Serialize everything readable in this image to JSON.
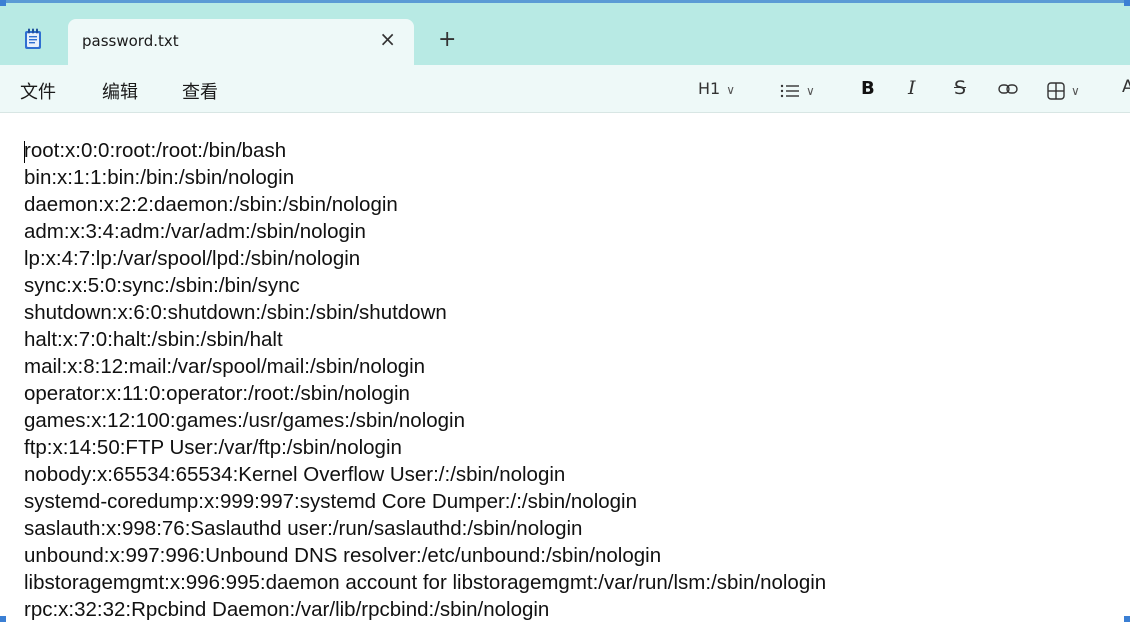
{
  "window": {
    "tab": {
      "title": "password.txt",
      "close_label": "×"
    },
    "new_tab_label": "+"
  },
  "menu": [
    "文件",
    "编辑",
    "查看"
  ],
  "toolbar": {
    "heading_label": "H1",
    "chevron": "∨",
    "list_icon": "list-icon",
    "bold_label": "B",
    "italic_label": "I",
    "strike_label": "S",
    "overflow_label": "A"
  },
  "editor": {
    "lines": [
      "root:x:0:0:root:/root:/bin/bash",
      "bin:x:1:1:bin:/bin:/sbin/nologin",
      "daemon:x:2:2:daemon:/sbin:/sbin/nologin",
      "adm:x:3:4:adm:/var/adm:/sbin/nologin",
      "lp:x:4:7:lp:/var/spool/lpd:/sbin/nologin",
      "sync:x:5:0:sync:/sbin:/bin/sync",
      "shutdown:x:6:0:shutdown:/sbin:/sbin/shutdown",
      "halt:x:7:0:halt:/sbin:/sbin/halt",
      "mail:x:8:12:mail:/var/spool/mail:/sbin/nologin",
      "operator:x:11:0:operator:/root:/sbin/nologin",
      "games:x:12:100:games:/usr/games:/sbin/nologin",
      "ftp:x:14:50:FTP User:/var/ftp:/sbin/nologin",
      "nobody:x:65534:65534:Kernel Overflow User:/:/sbin/nologin",
      "systemd-coredump:x:999:997:systemd Core Dumper:/:/sbin/nologin",
      "saslauth:x:998:76:Saslauthd user:/run/saslauthd:/sbin/nologin",
      "unbound:x:997:996:Unbound DNS resolver:/etc/unbound:/sbin/nologin",
      "libstoragemgmt:x:996:995:daemon account for libstoragemgmt:/var/run/lsm:/sbin/nologin",
      "rpc:x:32:32:Rpcbind Daemon:/var/lib/rpcbind:/sbin/nologin"
    ]
  },
  "colors": {
    "tabbar_bg": "#b8eae4",
    "active_tab_bg": "#eef9f8",
    "accent": "#3b7fd4"
  }
}
